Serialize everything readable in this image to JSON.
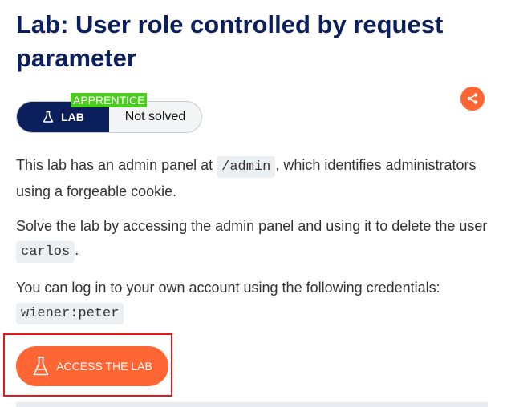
{
  "lab": {
    "title": "Lab: User role controlled by request parameter",
    "level": "APPRENTICE",
    "badge_label": "LAB",
    "status": "Not solved"
  },
  "description": {
    "p1_before": "This lab has an admin panel at ",
    "p1_code": "/admin",
    "p1_after": ", which identifies administrators using a forgeable cookie.",
    "p2_before": "Solve the lab by accessing the admin panel and using it to delete the user ",
    "p2_code": "carlos",
    "p2_after": ".",
    "p3_before": "You can log in to your own account using the following credentials: ",
    "p3_code": "wiener:peter"
  },
  "actions": {
    "access_label": "ACCESS THE LAB"
  },
  "icons": {
    "share": "share-icon",
    "flask": "flask-icon"
  },
  "colors": {
    "accent": "#ff6633",
    "navy": "#0a1f5c",
    "level_green": "#4ccc1f",
    "highlight_red": "#e51919"
  }
}
